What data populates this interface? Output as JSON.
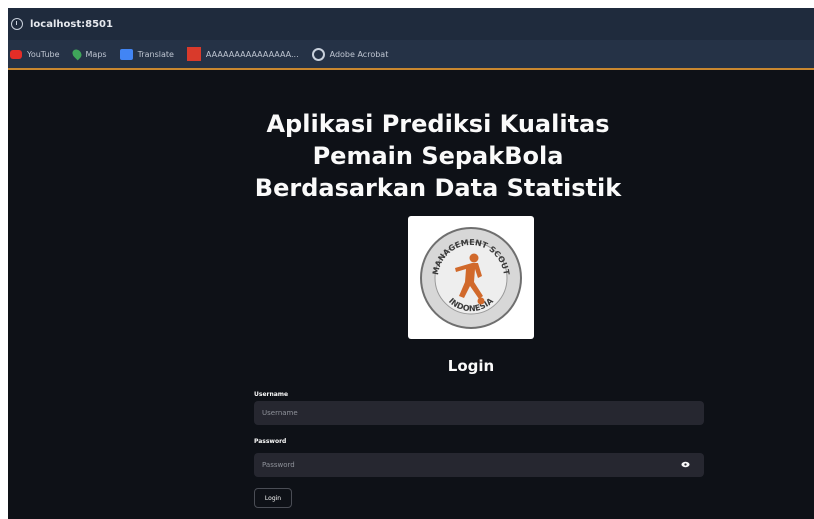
{
  "browser": {
    "address": "localhost:8501"
  },
  "bookmarks": [
    {
      "label": "YouTube",
      "icon": "youtube-icon"
    },
    {
      "label": "Maps",
      "icon": "maps-pin-icon"
    },
    {
      "label": "Translate",
      "icon": "translate-icon"
    },
    {
      "label": "AAAAAAAAAAAAAAA...",
      "icon": "red-square-icon"
    },
    {
      "label": "Adobe Acrobat",
      "icon": "compass-icon"
    }
  ],
  "page": {
    "title": "Aplikasi Prediksi Kualitas Pemain SepakBola Berdasarkan Data Statistik",
    "logo": {
      "top_text": "MANAGEMENT SCOUT",
      "bottom_text": "INDONESIA"
    },
    "login_heading": "Login",
    "username": {
      "label": "Username",
      "placeholder": "Username"
    },
    "password": {
      "label": "Password",
      "placeholder": "Password"
    },
    "login_button": "Login"
  },
  "colors": {
    "background": "#0e1117",
    "input": "#262730",
    "accent": "#c8872f",
    "logo_figure": "#d1692b"
  }
}
